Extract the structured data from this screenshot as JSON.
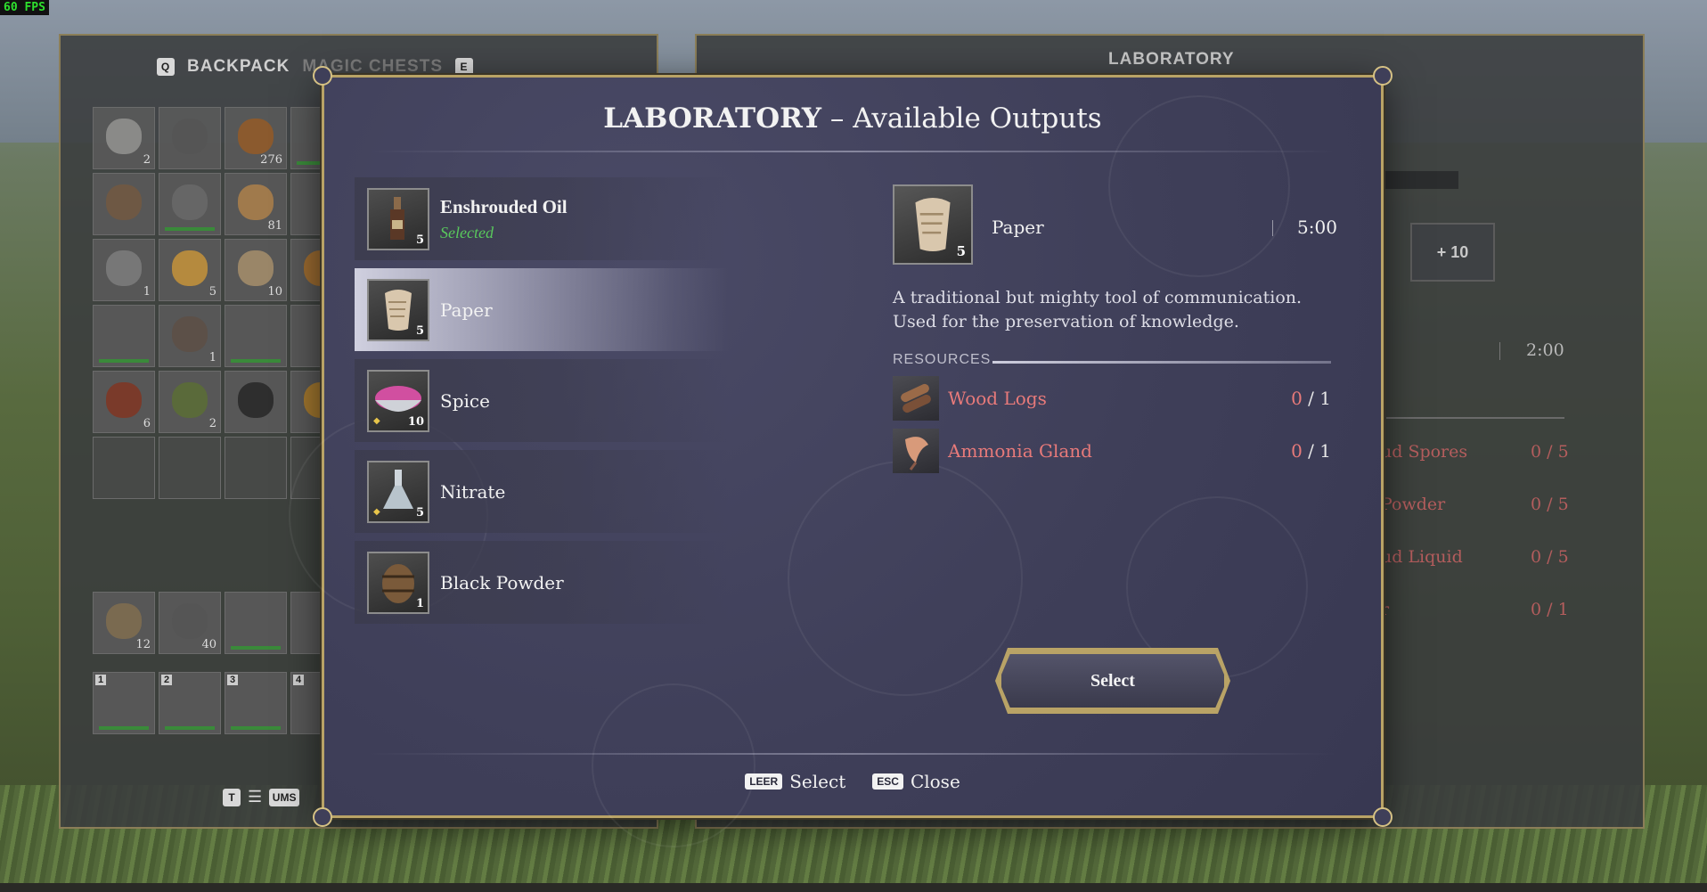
{
  "fps": "60 FPS",
  "backpack": {
    "tab_key_left": "Q",
    "tab_backpack": "BACKPACK",
    "tab_magic": "MAGIC CHESTS",
    "tab_key_right": "E",
    "slots_row": [
      [
        "2",
        "",
        "276",
        ""
      ],
      [
        "",
        "",
        "81",
        ""
      ],
      [
        "1",
        "5",
        "10",
        ""
      ],
      [
        "",
        "1",
        "",
        ""
      ],
      [
        "6",
        "2",
        "",
        ""
      ]
    ],
    "belt": [
      "12",
      "40",
      "",
      ""
    ],
    "hotbar": [
      "1",
      "2",
      "3",
      "4"
    ],
    "sort_key": "T",
    "ums_key": "UMS"
  },
  "lab_back": {
    "title": "LABORATORY",
    "plus": "+ 10",
    "time": "2:00",
    "resources": [
      {
        "name": "ud Spores",
        "qty": "0 / 5"
      },
      {
        "name": "Powder",
        "qty": "0 / 5"
      },
      {
        "name": "ud Liquid",
        "qty": "0 / 5"
      },
      {
        "name": "r",
        "qty": "0 / 1"
      }
    ]
  },
  "modal": {
    "title_bold": "LABORATORY",
    "title_rest": " – Available Outputs",
    "outputs": [
      {
        "name": "Enshrouded Oil",
        "status": "Selected",
        "qty": "5"
      },
      {
        "name": "Paper",
        "status": "",
        "qty": "5"
      },
      {
        "name": "Spice",
        "status": "",
        "qty": "10"
      },
      {
        "name": "Nitrate",
        "status": "",
        "qty": "5"
      },
      {
        "name": "Black Powder",
        "status": "",
        "qty": "1"
      }
    ],
    "detail": {
      "name": "Paper",
      "qty": "5",
      "time": "5:00",
      "description": "A traditional but mighty tool of communication. Used for the preservation of knowledge.",
      "resources_label": "RESOURCES",
      "resources": [
        {
          "name": "Wood Logs",
          "have": "0",
          "need": "/ 1"
        },
        {
          "name": "Ammonia Gland",
          "have": "0",
          "need": "/ 1"
        }
      ]
    },
    "select_button": "Select",
    "footer": {
      "select_key": "LEER",
      "select_label": "Select",
      "close_key": "ESC",
      "close_label": "Close"
    }
  },
  "colors": {
    "accent_gold": "#b9a366",
    "selected_green": "#59c85c",
    "missing_red": "#e87a7a"
  }
}
